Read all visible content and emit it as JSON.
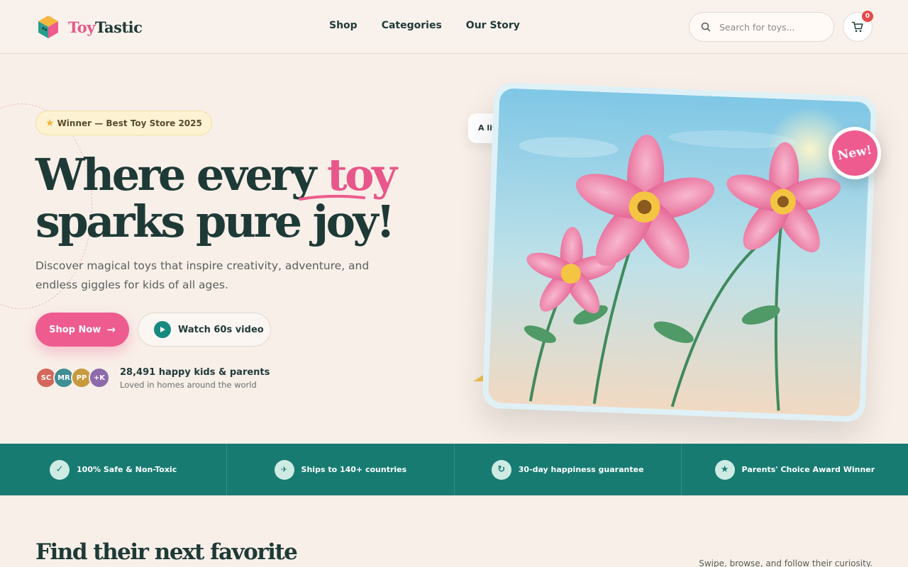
{
  "brand": {
    "name_part1": "Toy",
    "name_part2": "Tastic"
  },
  "nav": {
    "items": [
      "Shop",
      "Categories",
      "Our Story"
    ]
  },
  "search": {
    "placeholder": "Search for toys..."
  },
  "cart": {
    "count": "0"
  },
  "hero": {
    "badge": "Winner — Best Toy Store 2025",
    "headline_part1": "Where every ",
    "headline_highlight": "toy",
    "headline_line2": "sparks pure joy!",
    "subtitle": "Discover magical toys that inspire creativity, adventure, and endless giggles for kids of all ages.",
    "cta_primary": "Shop Now",
    "cta_secondary": "Watch 60s video",
    "social_avatars": [
      {
        "initials": "SC",
        "color": "#d4665a"
      },
      {
        "initials": "MR",
        "color": "#3f8e94"
      },
      {
        "initials": "PP",
        "color": "#c79a3e"
      },
      {
        "initials": "+K",
        "color": "#8d6aa9"
      }
    ],
    "social_title": "28,491 happy kids & parents",
    "social_subtitle": "Loved in homes around the world",
    "tooltip_text": "A lit",
    "new_badge": "New!"
  },
  "trust": [
    {
      "icon": "check-icon",
      "glyph": "✓",
      "label": "100% Safe & Non-Toxic"
    },
    {
      "icon": "plane-icon",
      "glyph": "✈",
      "label": "Ships to 140+ countries"
    },
    {
      "icon": "refresh-icon",
      "glyph": "↻",
      "label": "30-day happiness guarantee"
    },
    {
      "icon": "star-icon",
      "glyph": "★",
      "label": "Parents' Choice Award Winner"
    }
  ],
  "section": {
    "title": "Find their next favorite",
    "subtitle": "Swipe, browse, and follow their curiosity."
  },
  "colors": {
    "accent_pink": "#ee5b8e",
    "teal": "#177b72",
    "dark": "#1e3a37",
    "background": "#f8efe8"
  }
}
